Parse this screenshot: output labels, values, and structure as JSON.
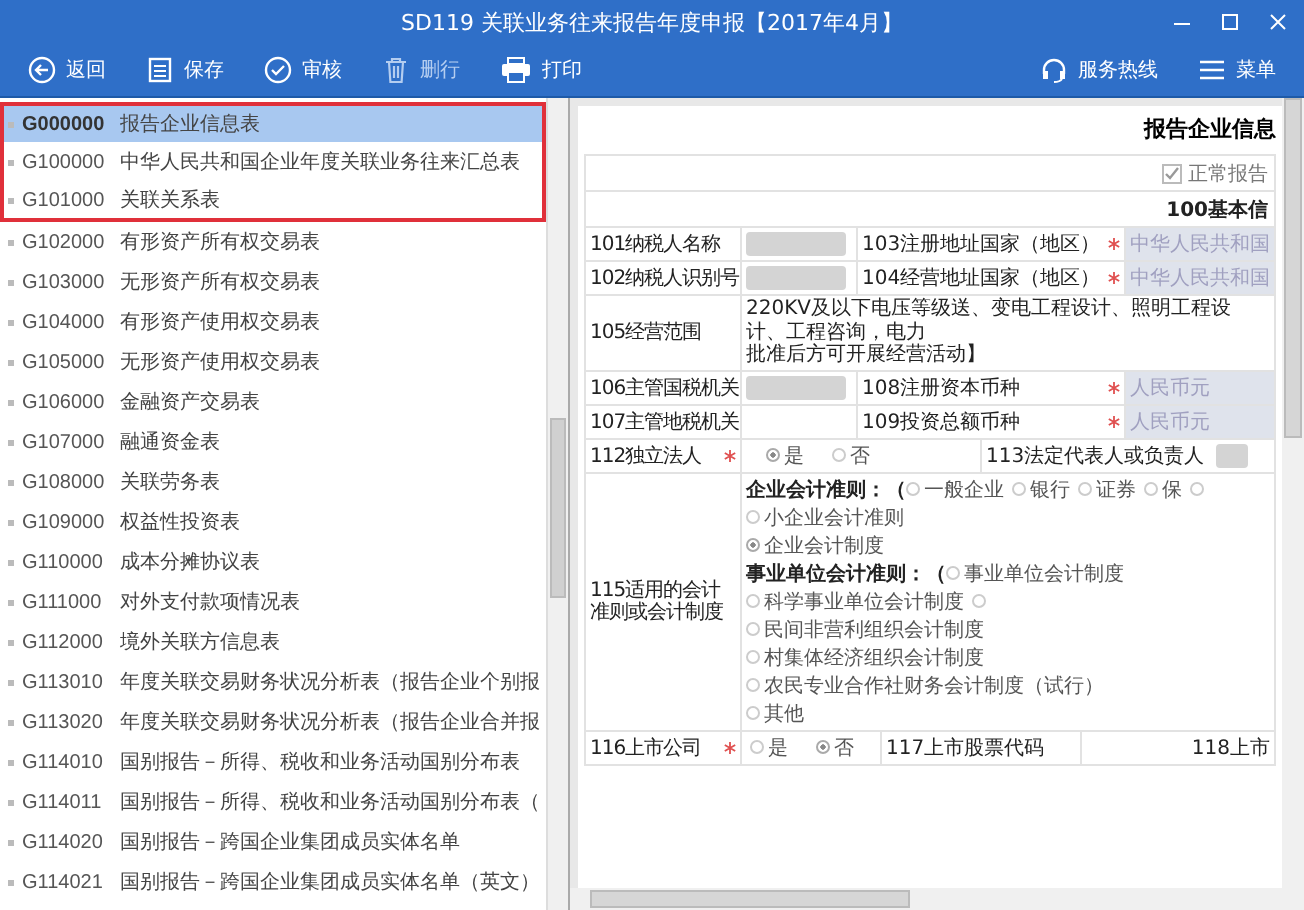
{
  "window": {
    "title": "SD119 关联业务往来报告年度申报【2017年4月】"
  },
  "toolbar": {
    "buttons": [
      {
        "kind": "back",
        "label": "返回",
        "disabled": false
      },
      {
        "kind": "save",
        "label": "保存",
        "disabled": false
      },
      {
        "kind": "check",
        "label": "审核",
        "disabled": false
      },
      {
        "kind": "delete",
        "label": "删行",
        "disabled": true
      },
      {
        "kind": "print",
        "label": "打印",
        "disabled": false
      }
    ],
    "right_buttons": [
      {
        "kind": "headset",
        "label": "服务热线"
      },
      {
        "kind": "menu",
        "label": "菜单"
      }
    ]
  },
  "sidebar": {
    "items": [
      {
        "code": "G000000",
        "name": "报告企业信息表",
        "selected": true,
        "outlined": true
      },
      {
        "code": "G100000",
        "name": "中华人民共和国企业年度关联业务往来汇总表",
        "selected": false,
        "outlined": true
      },
      {
        "code": "G101000",
        "name": "关联关系表",
        "selected": false,
        "outlined": true
      },
      {
        "code": "G102000",
        "name": "有形资产所有权交易表",
        "selected": false,
        "outlined": false
      },
      {
        "code": "G103000",
        "name": "无形资产所有权交易表",
        "selected": false,
        "outlined": false
      },
      {
        "code": "G104000",
        "name": "有形资产使用权交易表",
        "selected": false,
        "outlined": false
      },
      {
        "code": "G105000",
        "name": "无形资产使用权交易表",
        "selected": false,
        "outlined": false
      },
      {
        "code": "G106000",
        "name": "金融资产交易表",
        "selected": false,
        "outlined": false
      },
      {
        "code": "G107000",
        "name": "融通资金表",
        "selected": false,
        "outlined": false
      },
      {
        "code": "G108000",
        "name": "关联劳务表",
        "selected": false,
        "outlined": false
      },
      {
        "code": "G109000",
        "name": "权益性投资表",
        "selected": false,
        "outlined": false
      },
      {
        "code": "G110000",
        "name": "成本分摊协议表",
        "selected": false,
        "outlined": false
      },
      {
        "code": "G111000",
        "name": "对外支付款项情况表",
        "selected": false,
        "outlined": false
      },
      {
        "code": "G112000",
        "name": "境外关联方信息表",
        "selected": false,
        "outlined": false
      },
      {
        "code": "G113010",
        "name": "年度关联交易财务状况分析表（报告企业个别报",
        "selected": false,
        "outlined": false
      },
      {
        "code": "G113020",
        "name": "年度关联交易财务状况分析表（报告企业合并报",
        "selected": false,
        "outlined": false
      },
      {
        "code": "G114010",
        "name": "国别报告－所得、税收和业务活动国别分布表",
        "selected": false,
        "outlined": false
      },
      {
        "code": "G114011",
        "name": "国别报告－所得、税收和业务活动国别分布表（",
        "selected": false,
        "outlined": false
      },
      {
        "code": "G114020",
        "name": "国别报告－跨国企业集团成员实体名单",
        "selected": false,
        "outlined": false
      },
      {
        "code": "G114021",
        "name": "国别报告－跨国企业集团成员实体名单（英文）",
        "selected": false,
        "outlined": false
      }
    ]
  },
  "form": {
    "title": "报告企业信息",
    "normal_report": {
      "label": "正常报告",
      "checked": true
    },
    "section": "100基本信",
    "pair_rows": [
      {
        "label": "101纳税人名称",
        "redacted": true,
        "label2": "103注册地址国家（地区）",
        "required2": true,
        "value2": "中华人民共和国"
      },
      {
        "label": "102纳税人识别号",
        "redacted": true,
        "label2": "104经营地址国家（地区）",
        "required2": true,
        "value2": "中华人民共和国"
      },
      {
        "label": "105经营范围",
        "kind": "scope",
        "lines": [
          "220KV及以下电压等级送、变电工程设计、照明工程设计、工程咨询，电力",
          "批准后方可开展经营活动】"
        ]
      },
      {
        "label": "106主管国税机关",
        "redacted": true,
        "label2": "108注册资本币种",
        "required2": true,
        "value2": "人民币元"
      },
      {
        "label": "107主管地税机关",
        "redacted": false,
        "label2": "109投资总额币种",
        "required2": true,
        "value2": "人民币元"
      }
    ],
    "legal_person": {
      "label": "112独立法人",
      "required": true,
      "options": [
        {
          "label": "是",
          "selected": true
        },
        {
          "label": "否",
          "selected": false
        }
      ],
      "label2": "113法定代表人或负责人",
      "redacted": true
    },
    "accounting": {
      "label": "115适用的会计准则或会计制度",
      "lines": [
        {
          "prefix": "企业会计准则：（",
          "options": [
            {
              "label": "一般企业",
              "selected": false
            },
            {
              "label": "银行",
              "selected": false
            },
            {
              "label": "证券",
              "selected": false
            },
            {
              "label": "保",
              "selected": false
            },
            {
              "selected": false
            }
          ]
        },
        {
          "options": [
            {
              "label": "小企业会计准则",
              "selected": false
            }
          ]
        },
        {
          "options": [
            {
              "label": "企业会计制度",
              "selected": true
            }
          ]
        },
        {
          "prefix": "事业单位会计准则：（",
          "options": [
            {
              "label": "事业单位会计制度",
              "selected": false
            },
            {
              "label": "科学事业单位会计制度",
              "selected": false
            },
            {
              "selected": false
            }
          ]
        },
        {
          "options": [
            {
              "label": "民间非营利组织会计制度",
              "selected": false
            }
          ]
        },
        {
          "options": [
            {
              "label": "村集体经济组织会计制度",
              "selected": false
            }
          ]
        },
        {
          "options": [
            {
              "label": "农民专业合作社财务会计制度（试行）",
              "selected": false
            }
          ]
        },
        {
          "options": [
            {
              "label": "其他",
              "selected": false
            }
          ]
        }
      ]
    },
    "listed": {
      "label": "116上市公司",
      "required": true,
      "options": [
        {
          "label": "是",
          "selected": false
        },
        {
          "label": "否",
          "selected": true
        }
      ],
      "label2": "117上市股票代码",
      "label3": "118上市"
    }
  }
}
